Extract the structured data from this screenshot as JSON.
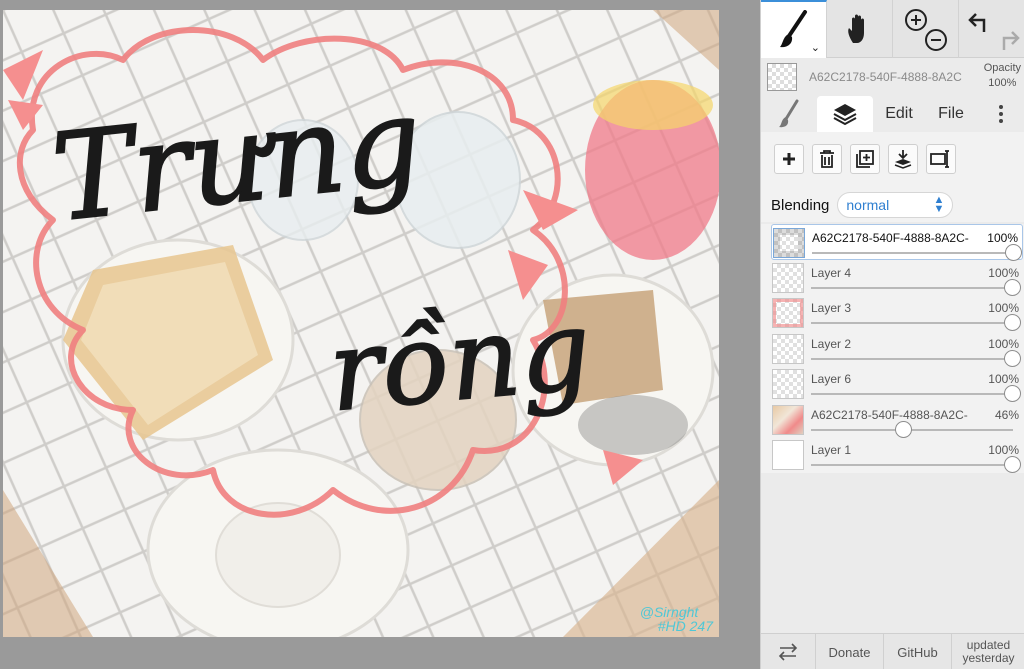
{
  "canvas": {
    "lettering_line1": "Trưng",
    "lettering_line2": "rồng",
    "watermark_line1": "@Sirnght",
    "watermark_line2": "#HD 247"
  },
  "toolbar": {
    "brush_icon": "brush-icon",
    "hand_icon": "hand-icon",
    "zoom_icons": [
      "zoom-in-icon",
      "zoom-out-icon"
    ],
    "history_icons": [
      "undo-icon",
      "redo-icon"
    ],
    "accent": "#3b8fd9"
  },
  "document": {
    "name": "A62C2178-540F-4888-8A2C",
    "opacity_label": "Opacity",
    "opacity_value": "100%"
  },
  "tabs": {
    "brush_tab_icon": "brush-icon",
    "layers_tab_icon": "layers-icon",
    "edit": "Edit",
    "file": "File",
    "more_icon": "more-vertical-icon"
  },
  "layer_actions": [
    "add-layer-icon",
    "delete-layer-icon",
    "duplicate-layer-icon",
    "merge-down-icon",
    "layer-properties-icon"
  ],
  "blending": {
    "label": "Blending",
    "value": "normal"
  },
  "layers": [
    {
      "name": "A62C2178-540F-4888-8A2C-",
      "opacity": "100%",
      "level": 1.0,
      "selected": true,
      "thumb": "lettering"
    },
    {
      "name": "Layer 4",
      "opacity": "100%",
      "level": 1.0,
      "selected": false,
      "thumb": "transparent"
    },
    {
      "name": "Layer 3",
      "opacity": "100%",
      "level": 1.0,
      "selected": false,
      "thumb": "pink-outline"
    },
    {
      "name": "Layer 2",
      "opacity": "100%",
      "level": 1.0,
      "selected": false,
      "thumb": "transparent"
    },
    {
      "name": "Layer 6",
      "opacity": "100%",
      "level": 1.0,
      "selected": false,
      "thumb": "transparent"
    },
    {
      "name": "A62C2178-540F-4888-8A2C-",
      "opacity": "46%",
      "level": 0.46,
      "selected": false,
      "thumb": "photo"
    },
    {
      "name": "Layer 1",
      "opacity": "100%",
      "level": 1.0,
      "selected": false,
      "thumb": "white"
    }
  ],
  "bottom": {
    "swap_icon": "swap-icon",
    "donate": "Donate",
    "github": "GitHub",
    "updated_line1": "updated",
    "updated_line2": "yesterday"
  }
}
